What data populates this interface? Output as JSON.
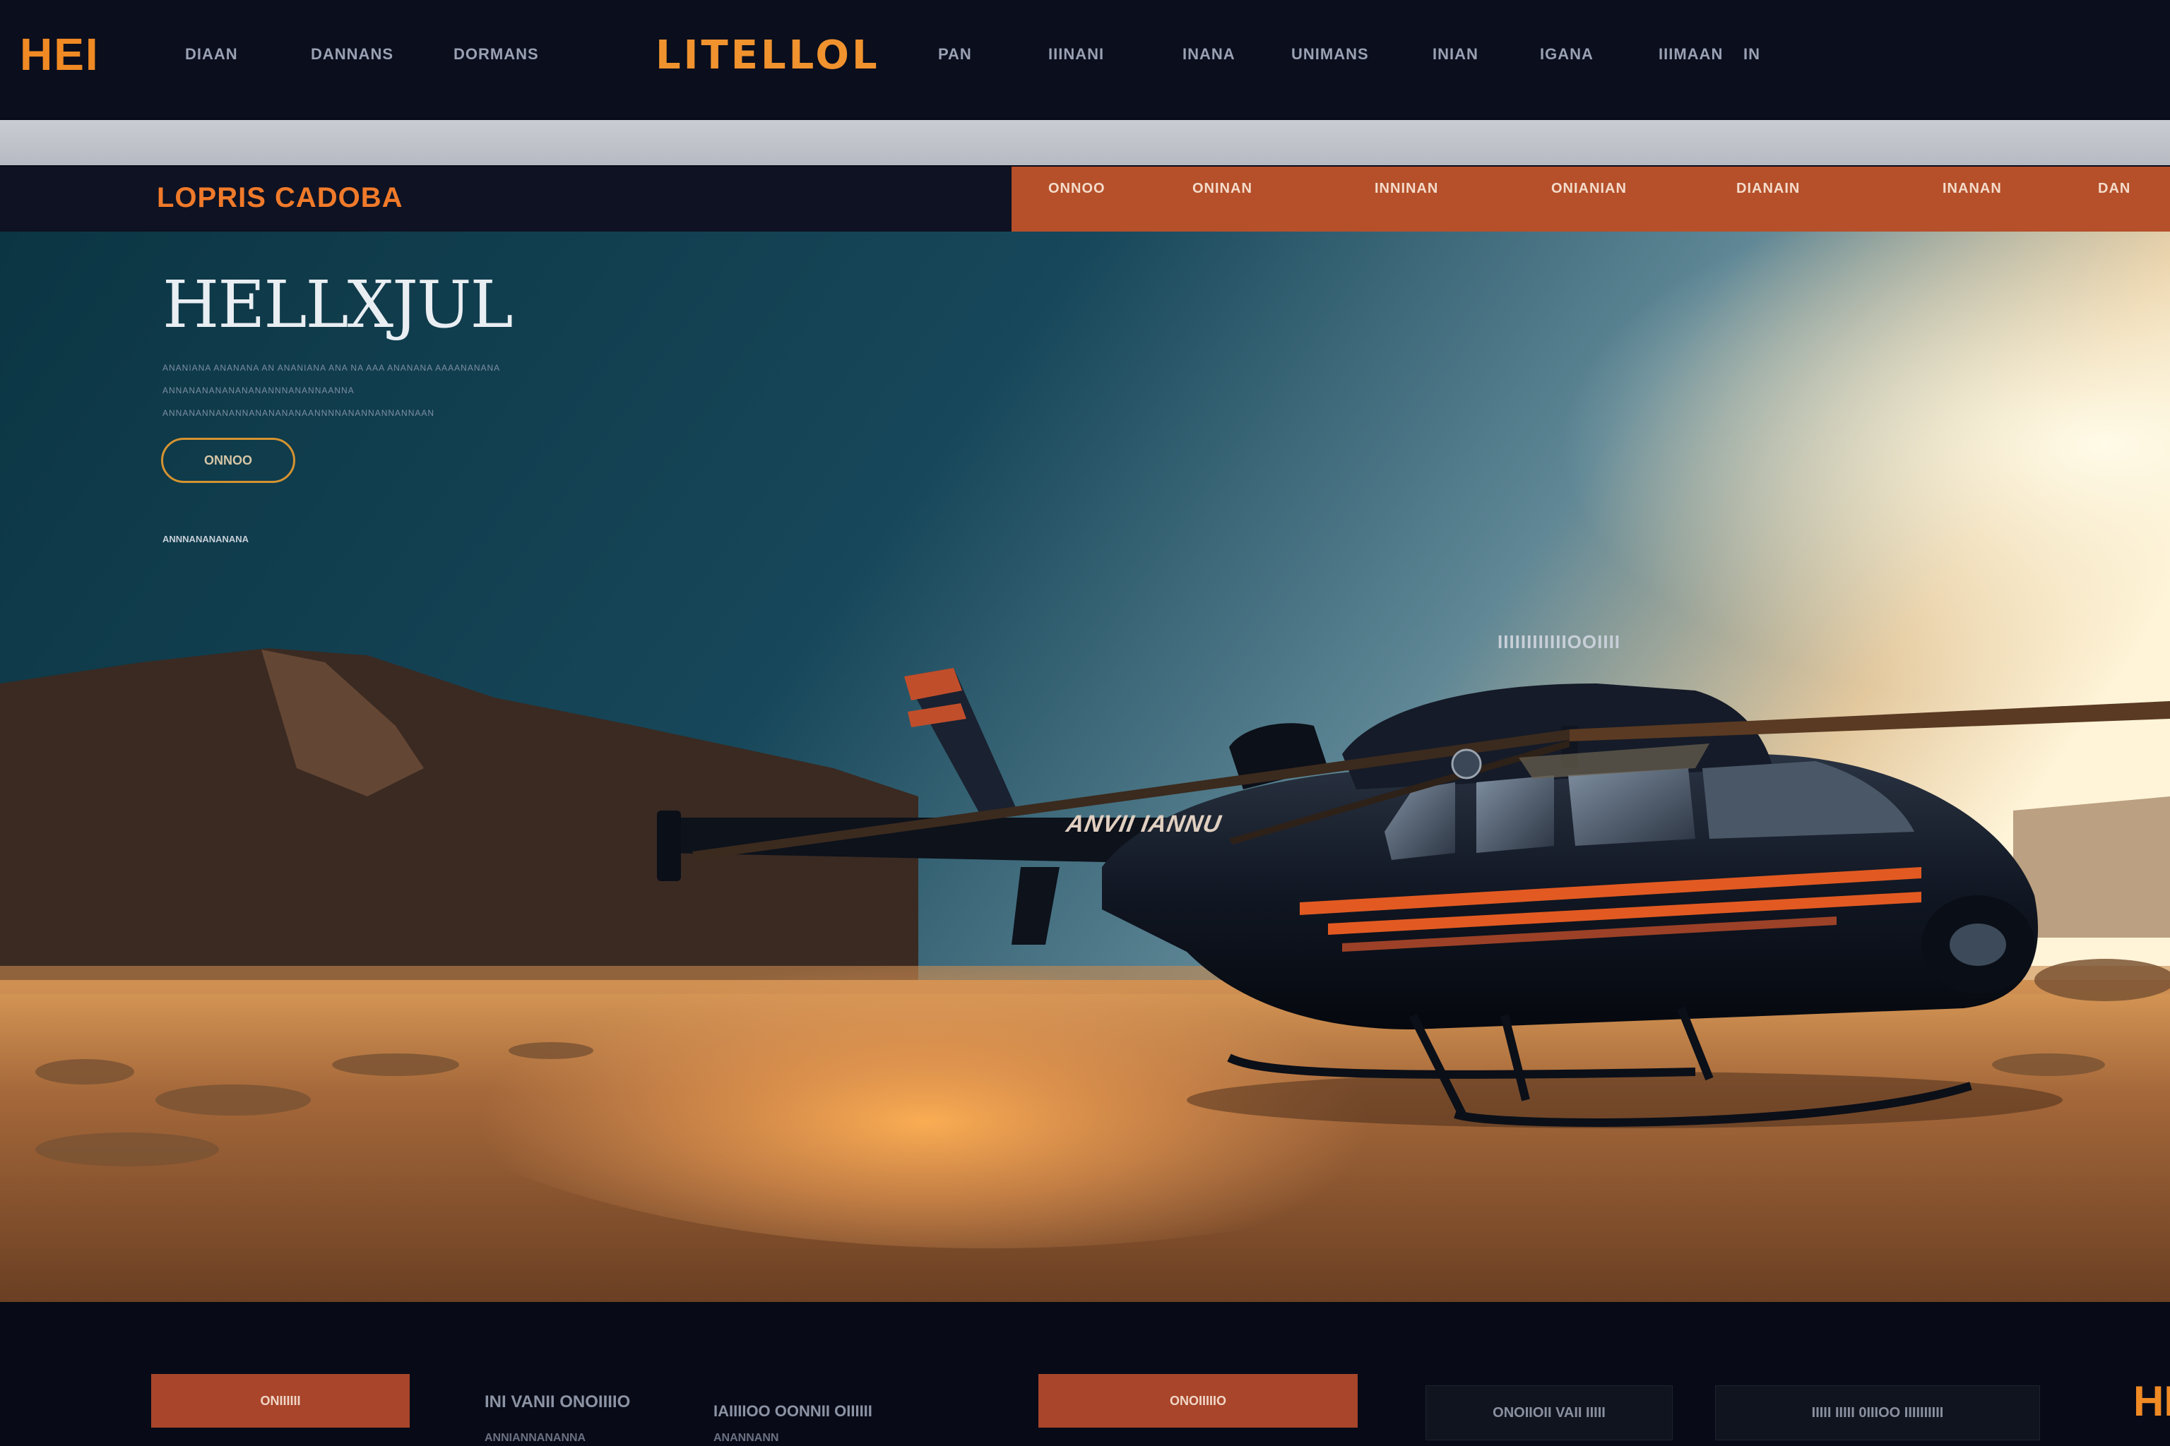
{
  "header": {
    "logo": "HEI",
    "brand": "LITELLOL",
    "nav_left": [
      "DIAAN",
      "DANNANS",
      "DORMANS"
    ],
    "nav_right": [
      "PAN",
      "IIINANI",
      "INANA",
      "UNIMANS",
      "INIAN",
      "IGANA",
      "IIIMAAN",
      "IN"
    ]
  },
  "subheader": {
    "title": "LOPRIS CADOBA",
    "links": [
      "ONNOO",
      "ONINAN",
      "INNINAN",
      "ONIANIAN",
      "DIANAIN",
      "INANAN",
      "DAN"
    ]
  },
  "hero": {
    "title": "HELLXJUL",
    "line1": "ANANIANA ANANANA AN ANANIANA ANA NA AAA ANANANA AAAANANANA",
    "line2": "ANNANANANANANANANNNANANNAANNA",
    "line3": "ANNANANNANANNANANANANAANNNNANANNANNANNAAN",
    "button_label": "ONNOO",
    "small_text": "ANNNANANANANA",
    "helicopter_fuselage_text": "IIIIIIIIIIIIOOIIII",
    "helicopter_tail_text": "ANVII IANNU",
    "colors": {
      "accent": "#f08a24",
      "rust": "#b5502b",
      "navy": "#0a0e1d"
    }
  },
  "footer": {
    "button1": "ONIIIIII",
    "text1": "INI VANII ONOIIIIO",
    "text1b": "ANNIANNANANNA",
    "text2": "IAIIIIOO OONNII OIIIIII",
    "text2b": "ANANNANN",
    "button2": "ONOIIIIIO",
    "box1": "ONOIIOII VAII IIIII",
    "box2": "IIIII IIIII 0IIIOO IIIIIIIIII",
    "logo": "HE"
  }
}
